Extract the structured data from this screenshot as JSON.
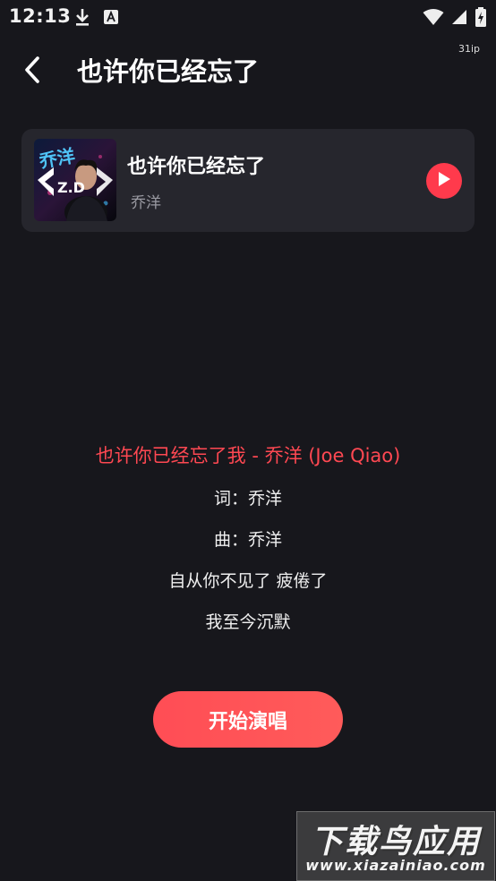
{
  "status_bar": {
    "time": "12:13",
    "net_speed": "31ip",
    "icons": [
      "download-icon",
      "font-a-icon",
      "wifi-icon",
      "signal-icon",
      "battery-icon"
    ]
  },
  "header": {
    "title": "也许你已经忘了",
    "back_icon": "chevron-left-icon"
  },
  "song": {
    "title": "也许你已经忘了",
    "artist": "乔洋",
    "cover_text": "乔洋"
  },
  "lyrics": [
    "也许你已经忘了我 - 乔洋 (Joe Qiao)",
    "词：乔洋",
    "曲：乔洋",
    "自从你不见了 疲倦了",
    "我至今沉默"
  ],
  "start_button_label": "开始演唱",
  "watermark": {
    "main": "下载鸟应用",
    "url": "www.xiazainiao.com"
  },
  "colors": {
    "background": "#17171c",
    "card": "#26262d",
    "accent": "#ff4852",
    "muted_text": "#9a9aa2"
  }
}
